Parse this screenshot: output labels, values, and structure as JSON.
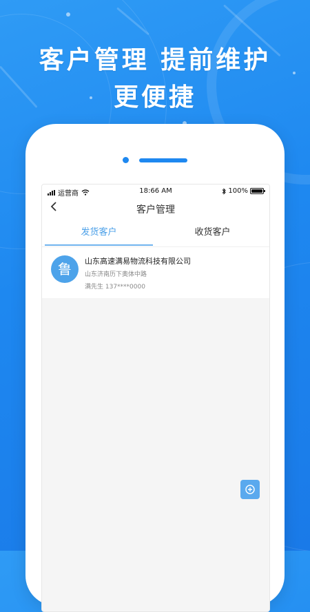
{
  "promo": {
    "line1": "客户管理 提前维护",
    "line2": "更便捷"
  },
  "status_bar": {
    "carrier": "运营商",
    "time": "18:66 AM",
    "battery": "100%"
  },
  "nav": {
    "back_icon": "chevron-left-icon",
    "title": "客户管理"
  },
  "tabs": [
    {
      "label": "发货客户",
      "active": true
    },
    {
      "label": "收货客户",
      "active": false
    }
  ],
  "customers": [
    {
      "avatar_char": "鲁",
      "name": "山东高速满易物流科技有限公司",
      "address": "山东济南历下奥体中路",
      "contact": "满先生 137****0000"
    }
  ],
  "colors": {
    "background": "#1e88f0",
    "accent": "#4a9fe8",
    "avatar": "#4da3ea",
    "fab": "#5aa9ee"
  }
}
